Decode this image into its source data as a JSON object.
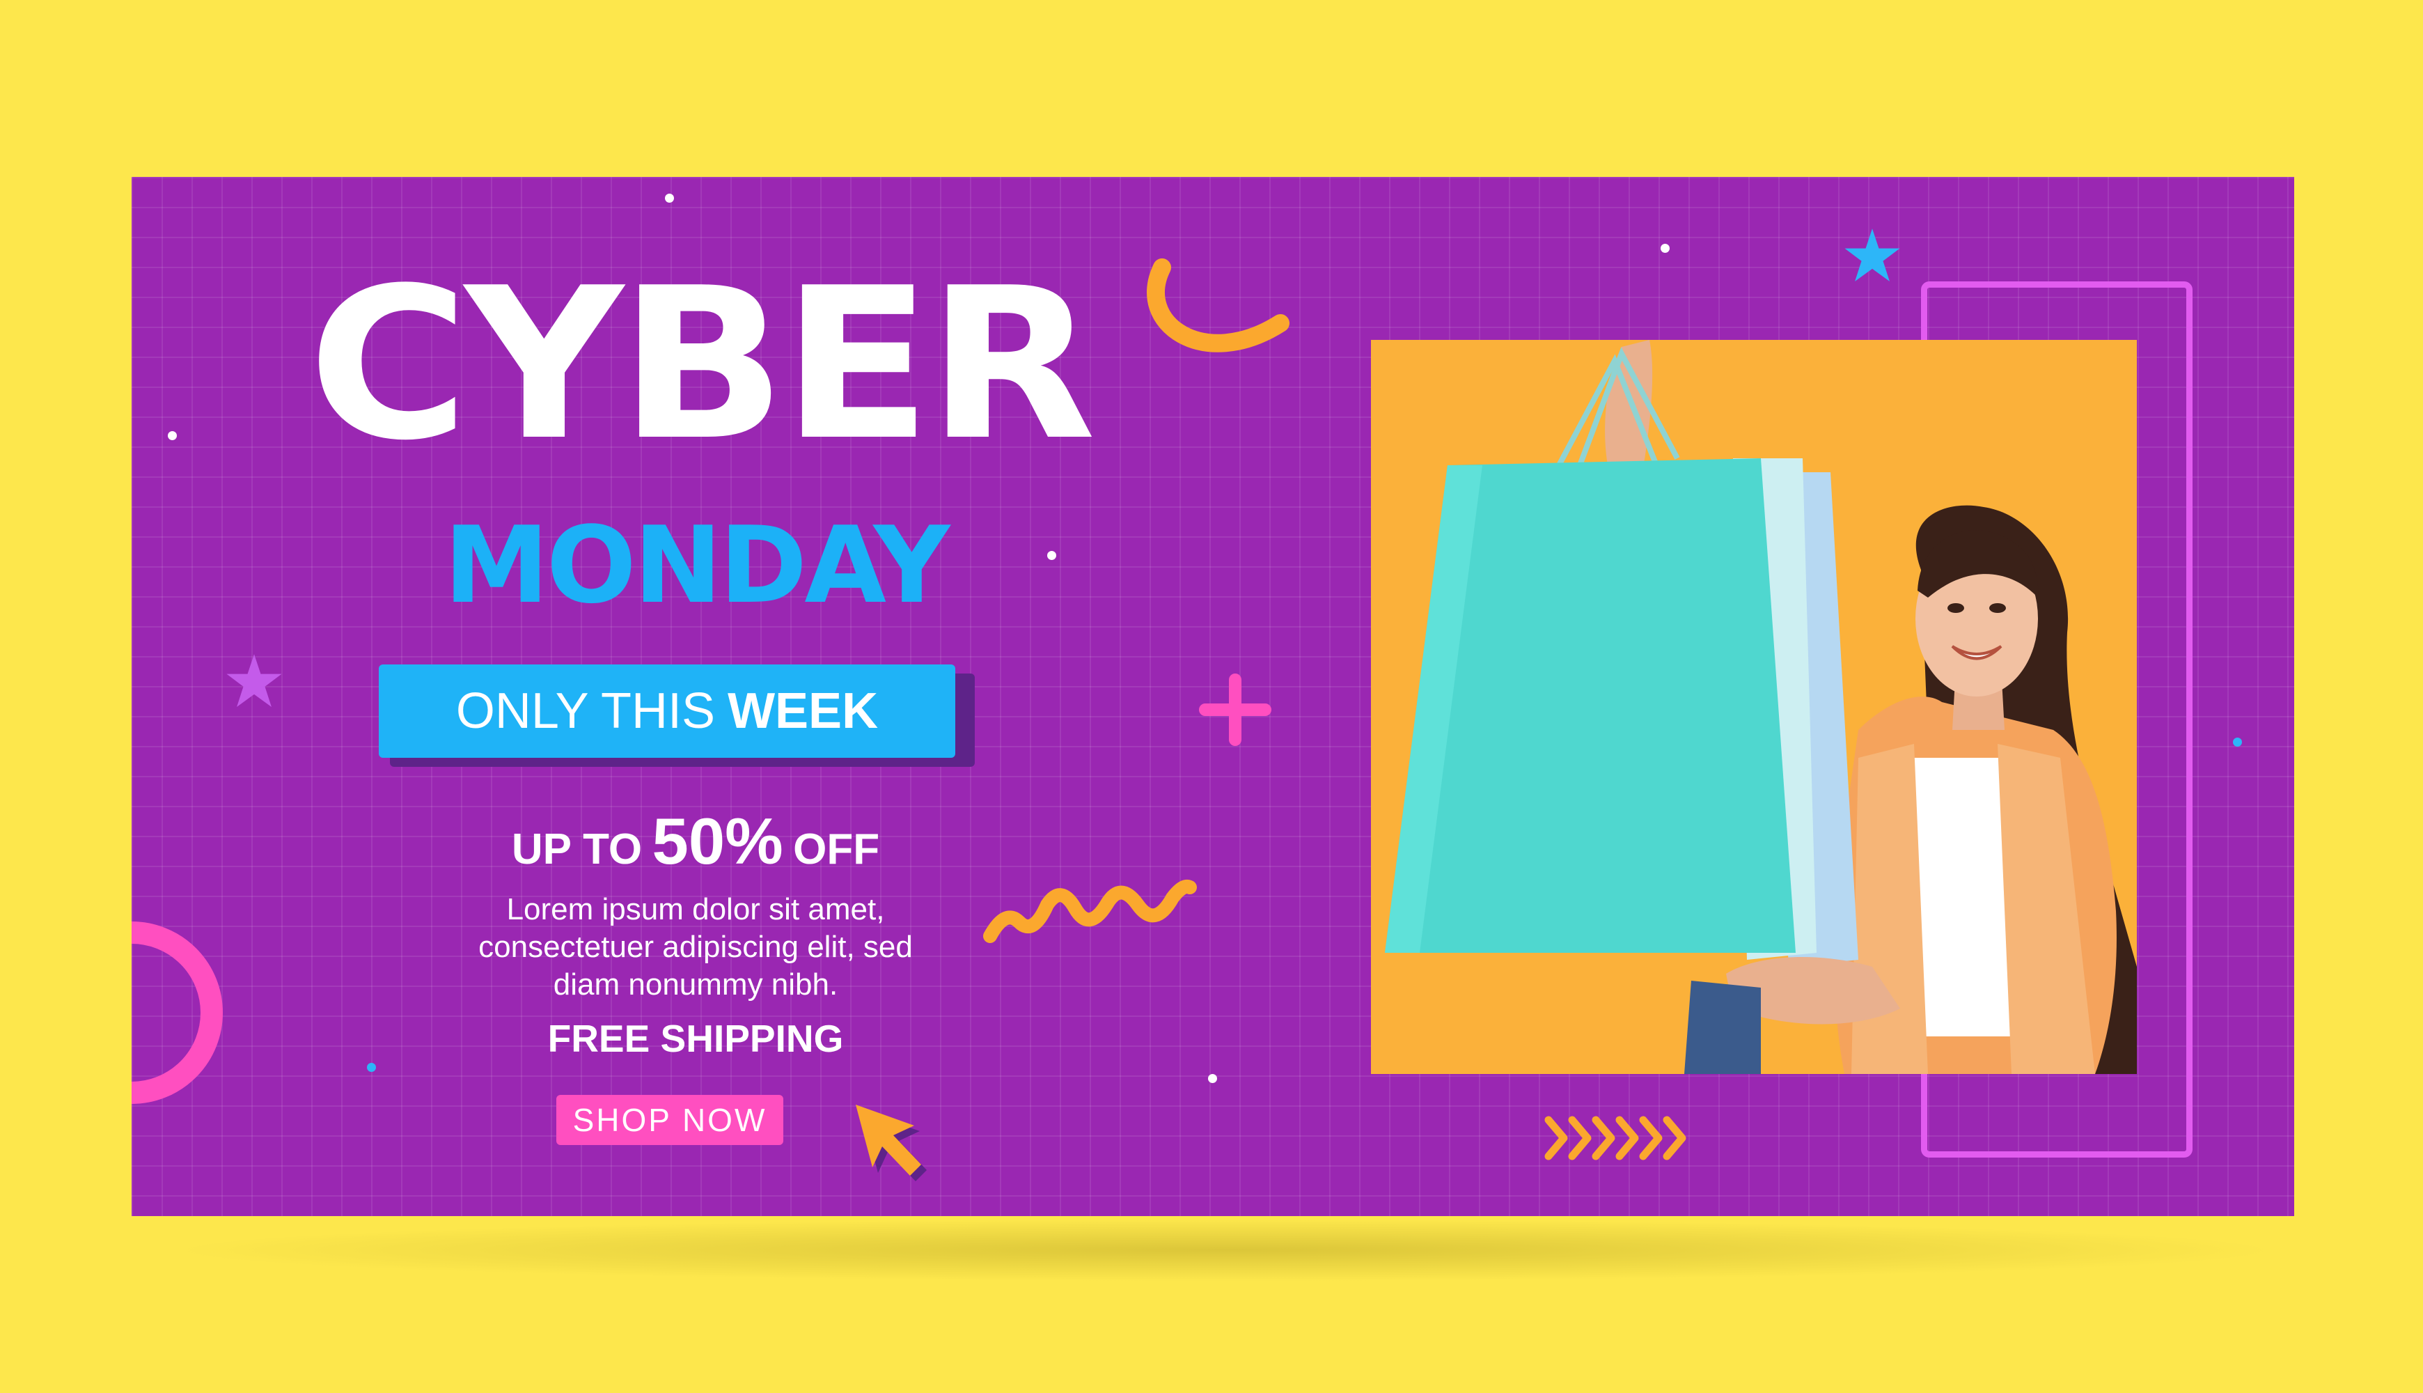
{
  "banner": {
    "title_line1": "CYBER",
    "title_line2": "MONDAY",
    "week": {
      "prefix": "ONLY THIS",
      "emphasis": "WEEK"
    },
    "discount": {
      "prefix": "UP TO",
      "amount": "50%",
      "suffix": "OFF"
    },
    "description": [
      "Lorem ipsum dolor sit amet,",
      "consectetuer adipiscing elit, sed",
      "diam nonummy nibh."
    ],
    "shipping": "FREE SHIPPING",
    "cta_label": "SHOP NOW"
  },
  "colors": {
    "page_background": "#FDE74C",
    "banner_background": "#9A27B2",
    "accent_blue": "#1FB3F7",
    "accent_pink": "#FF4FC0",
    "accent_orange": "#FBB13A",
    "photo_background": "#FBB13A"
  },
  "icons": [
    "star-icon",
    "cursor-arrow-icon",
    "plus-icon",
    "zigzag-decoration",
    "chevrons-decoration",
    "arc-decoration"
  ]
}
